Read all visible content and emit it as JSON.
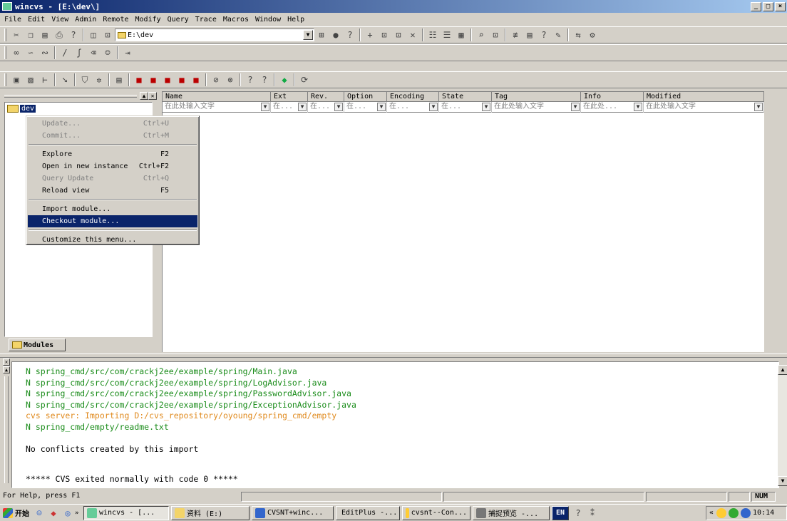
{
  "window": {
    "title": "wincvs - [E:\\dev\\]",
    "min": "_",
    "max": "□",
    "close": "×"
  },
  "menu": [
    "File",
    "Edit",
    "View",
    "Admin",
    "Remote",
    "Modify",
    "Query",
    "Trace",
    "Macros",
    "Window",
    "Help"
  ],
  "toolbar": {
    "path_combo": "E:\\dev"
  },
  "tree": {
    "root": "dev",
    "tab": "Modules"
  },
  "columns": [
    {
      "name": "Name",
      "filter": "在此处输入文字"
    },
    {
      "name": "Ext",
      "filter": "在..."
    },
    {
      "name": "Rev.",
      "filter": "在..."
    },
    {
      "name": "Option",
      "filter": "在..."
    },
    {
      "name": "Encoding",
      "filter": "在..."
    },
    {
      "name": "State",
      "filter": "在..."
    },
    {
      "name": "Tag",
      "filter": "在此处输入文字"
    },
    {
      "name": "Info",
      "filter": "在此处..."
    },
    {
      "name": "Modified",
      "filter": "在此处输入文字"
    }
  ],
  "context_menu": [
    {
      "label": "Update...",
      "shortcut": "Ctrl+U",
      "state": "disabled"
    },
    {
      "label": "Commit...",
      "shortcut": "Ctrl+M",
      "state": "disabled"
    },
    {
      "sep": true
    },
    {
      "label": "Explore",
      "shortcut": "F2",
      "state": "enabled"
    },
    {
      "label": "Open in new instance",
      "shortcut": "Ctrl+F2",
      "state": "enabled"
    },
    {
      "label": "Query Update",
      "shortcut": "Ctrl+Q",
      "state": "disabled"
    },
    {
      "label": "Reload view",
      "shortcut": "F5",
      "state": "enabled"
    },
    {
      "sep": true
    },
    {
      "label": "Import module...",
      "shortcut": "",
      "state": "enabled"
    },
    {
      "label": "Checkout module...",
      "shortcut": "",
      "state": "selected"
    },
    {
      "sep": true
    },
    {
      "label": "Customize this menu...",
      "shortcut": "",
      "state": "enabled"
    }
  ],
  "output": [
    {
      "text": "N spring_cmd/src/com/crackj2ee/example/spring/Main.java",
      "color": "#1a8c1a"
    },
    {
      "text": "N spring_cmd/src/com/crackj2ee/example/spring/LogAdvisor.java",
      "color": "#1a8c1a"
    },
    {
      "text": "N spring_cmd/src/com/crackj2ee/example/spring/PasswordAdvisor.java",
      "color": "#1a8c1a"
    },
    {
      "text": "N spring_cmd/src/com/crackj2ee/example/spring/ExceptionAdvisor.java",
      "color": "#1a8c1a"
    },
    {
      "text": "cvs server: Importing D:/cvs_repository/oyoung/spring_cmd/empty",
      "color": "#e08a1e"
    },
    {
      "text": "N spring_cmd/empty/readme.txt",
      "color": "#1a8c1a"
    },
    {
      "text": "",
      "color": "#000000"
    },
    {
      "text": "No conflicts created by this import",
      "color": "#000000"
    },
    {
      "text": "",
      "color": "#000000"
    },
    {
      "text": "",
      "color": "#000000"
    },
    {
      "text": "***** CVS exited normally with code 0 *****",
      "color": "#000000"
    }
  ],
  "status": {
    "help": "For Help, press F1",
    "num": "NUM"
  },
  "taskbar": {
    "start": "开始",
    "tasks": [
      "wincvs - [...",
      "资料 (E:)",
      "CVSNT+winc...",
      "EditPlus -...",
      "cvsnt--Con...",
      "捕捉预览 -..."
    ],
    "lang": "EN",
    "clock": "10:14"
  },
  "colors": {
    "accent": "#0a246a",
    "green": "#1a8c1a",
    "orange": "#e08a1e"
  }
}
